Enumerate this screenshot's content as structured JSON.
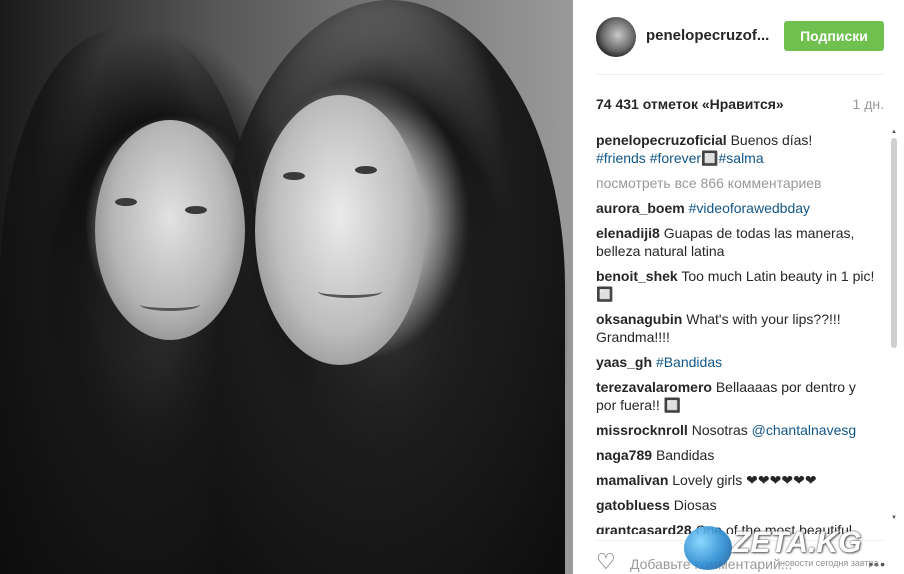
{
  "post": {
    "username": "penelopecruzof...",
    "follow_label": "Подписки",
    "likes": "74 431 отметок «Нравится»",
    "time": "1 дн."
  },
  "caption": {
    "user": "penelopecruzoficial",
    "text": "Buenos días!",
    "tags": [
      "#friends",
      "#forever",
      "#salma"
    ],
    "glyph": "🔲"
  },
  "view_all": "посмотреть все 866 комментариев",
  "comments": [
    {
      "user": "aurora_boem",
      "text": "",
      "tag": "#videoforawedbday",
      "tail": ""
    },
    {
      "user": "elenadiji8",
      "text": "Guapas de todas las maneras, belleza natural latina",
      "tag": "",
      "tail": ""
    },
    {
      "user": "benoit_shek",
      "text": "Too much Latin beauty in 1 pic!",
      "tag": "",
      "tail": "🔲"
    },
    {
      "user": "oksanagubin",
      "text": "What's with your lips??!!! Grandma!!!!",
      "tag": "",
      "tail": ""
    },
    {
      "user": "yaas_gh",
      "text": "",
      "tag": "#Bandidas",
      "tail": ""
    },
    {
      "user": "terezavalaromero",
      "text": "Bellaaaas por dentro y por fuera!!",
      "tag": "",
      "tail": "🔲"
    },
    {
      "user": "missrocknroll",
      "text": "Nosotras",
      "tag": "@chantalnavesg",
      "tail": ""
    },
    {
      "user": "naga789",
      "text": "Bandidas",
      "tag": "",
      "tail": ""
    },
    {
      "user": "mamalivan",
      "text": "Lovely girls ❤❤❤❤❤❤",
      "tag": "",
      "tail": ""
    },
    {
      "user": "gatobluess",
      "text": "Diosas",
      "tag": "",
      "tail": ""
    },
    {
      "user": "grantcasard28",
      "text": "One of the most beautiful",
      "tag": "",
      "tail": ""
    }
  ],
  "add_comment_placeholder": "Добавьте комментарий...",
  "more_glyph": "•••",
  "watermark": {
    "brand": "ZETA.KG",
    "sub": "новости сегодня завтра"
  },
  "icons": {
    "heart": "heart-icon",
    "more": "more-options-icon",
    "scroll_up": "scroll-up-icon",
    "scroll_down": "scroll-down-icon"
  },
  "colors": {
    "follow_btn": "#70c050",
    "hashtag": "#125688",
    "text": "#262626",
    "muted": "#999999"
  }
}
